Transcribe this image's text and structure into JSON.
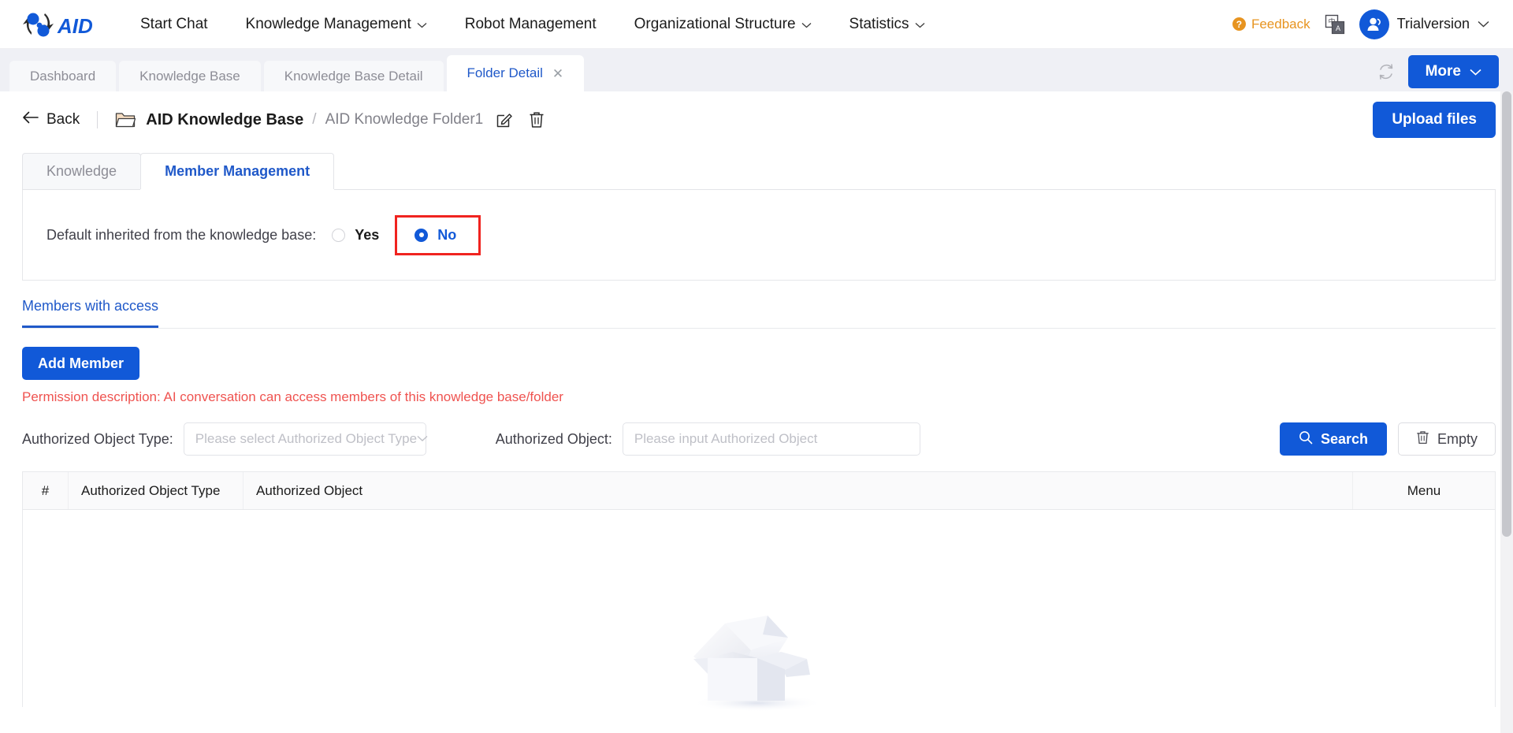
{
  "brand": {
    "name": "AID",
    "logo_icon": "aid-logo"
  },
  "topnav": {
    "items": [
      {
        "label": "Start Chat",
        "has_caret": false
      },
      {
        "label": "Knowledge Management",
        "has_caret": true
      },
      {
        "label": "Robot Management",
        "has_caret": false
      },
      {
        "label": "Organizational Structure",
        "has_caret": true
      },
      {
        "label": "Statistics",
        "has_caret": true
      }
    ],
    "feedback_label": "Feedback",
    "feedback_icon": "question-circle-icon",
    "language_icon": "translate-icon",
    "avatar_icon": "user-avatar-icon",
    "user_name": "Trialversion",
    "user_caret_icon": "chevron-down-icon"
  },
  "tabstrip": {
    "tabs": [
      {
        "label": "Dashboard",
        "active": false,
        "closable": false
      },
      {
        "label": "Knowledge Base",
        "active": false,
        "closable": false
      },
      {
        "label": "Knowledge Base Detail",
        "active": false,
        "closable": false
      },
      {
        "label": "Folder Detail",
        "active": true,
        "closable": true
      }
    ],
    "close_icon": "close-icon",
    "refresh_icon": "refresh-icon",
    "more_label": "More",
    "more_caret_icon": "chevron-down-icon"
  },
  "breadcrumb": {
    "back_label": "Back",
    "back_icon": "arrow-left-icon",
    "folder_icon": "folder-icon",
    "root": "AID Knowledge Base",
    "separator": "/",
    "current": "AID Knowledge Folder1",
    "edit_icon": "edit-icon",
    "delete_icon": "trash-icon",
    "upload_label": "Upload files"
  },
  "inner_tabs": [
    {
      "label": "Knowledge",
      "active": false
    },
    {
      "label": "Member Management",
      "active": true
    }
  ],
  "inherit": {
    "label": "Default inherited from the knowledge base:",
    "options": [
      {
        "label": "Yes",
        "selected": false
      },
      {
        "label": "No",
        "selected": true
      }
    ],
    "highlight_color": "#f0231f"
  },
  "members": {
    "section_tab": "Members with access",
    "add_member_label": "Add Member",
    "permission_note": "Permission description: AI conversation can access members of this knowledge base/folder",
    "permission_note_color": "#ef5350"
  },
  "filters": {
    "type_label": "Authorized Object Type:",
    "type_placeholder": "Please select Authorized Object Type",
    "type_value": "",
    "type_caret_icon": "chevron-down-icon",
    "object_label": "Authorized Object:",
    "object_placeholder": "Please input Authorized Object",
    "object_value": "",
    "search_label": "Search",
    "search_icon": "search-icon",
    "empty_label": "Empty",
    "empty_icon": "trash-icon"
  },
  "table": {
    "columns": [
      "#",
      "Authorized Object Type",
      "Authorized Object",
      "Menu"
    ],
    "rows": [],
    "empty_illustration": "empty-box-illustration"
  },
  "colors": {
    "primary": "#1159d8",
    "link": "#2059c9",
    "accent_orange": "#e79420",
    "danger": "#f0231f",
    "muted": "#8d8d96"
  }
}
